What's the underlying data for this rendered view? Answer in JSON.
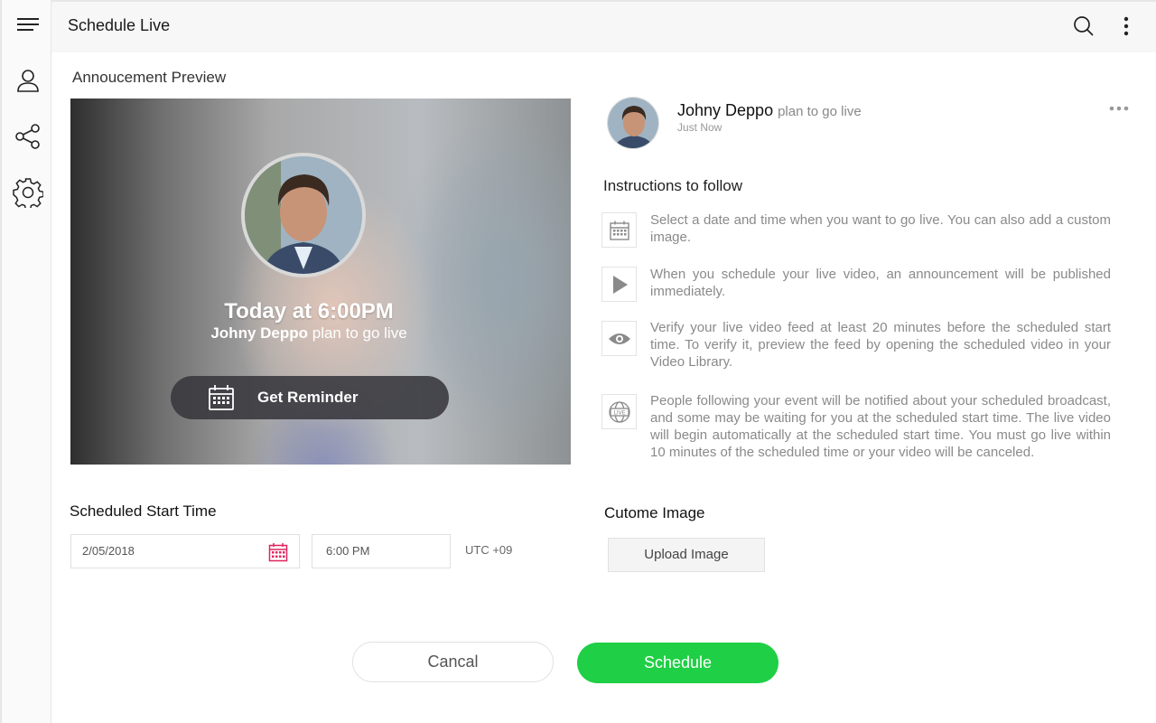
{
  "header": {
    "title": "Schedule Live"
  },
  "sidebar": {
    "items": [
      {
        "icon": "menu-icon"
      },
      {
        "icon": "user-icon"
      },
      {
        "icon": "share-icon"
      },
      {
        "icon": "gear-icon"
      }
    ]
  },
  "preview": {
    "section_title": "Annoucement Preview",
    "time_text": "Today at 6:00PM",
    "user_name": "Johny Deppo",
    "action_text": "plan to go live",
    "reminder_label": "Get Reminder"
  },
  "post": {
    "user_name": "Johny Deppo",
    "action_text": "plan to go live",
    "timestamp": "Just Now"
  },
  "instructions": {
    "title": "Instructions to follow",
    "items": [
      {
        "icon": "calendar-icon",
        "text": "Select a date and time when you want to go live. You can also add a custom image."
      },
      {
        "icon": "play-icon",
        "text": "When you schedule your live video, an announcement will be published immediately."
      },
      {
        "icon": "eye-icon",
        "text": "Verify your live video feed at least 20 minutes before the scheduled start time. To verify it, preview the feed by opening the scheduled video in your Video Library."
      },
      {
        "icon": "live-globe-icon",
        "text": "People following your event will be notified about your scheduled broadcast, and some may be waiting for you at the scheduled start time. The live video will begin automatically at the scheduled start time. You must go live within 10 minutes of the scheduled time or your video will be canceled."
      }
    ]
  },
  "schedule": {
    "title": "Scheduled Start Time",
    "date_value": "2/05/2018",
    "time_value": "6:00 PM",
    "timezone": "UTC +09"
  },
  "custom_image": {
    "title": "Cutome Image",
    "upload_label": "Upload Image"
  },
  "actions": {
    "cancel_label": "Cancal",
    "schedule_label": "Schedule"
  },
  "colors": {
    "accent_green": "#1fcf45",
    "calendar_red": "#e0245e"
  }
}
